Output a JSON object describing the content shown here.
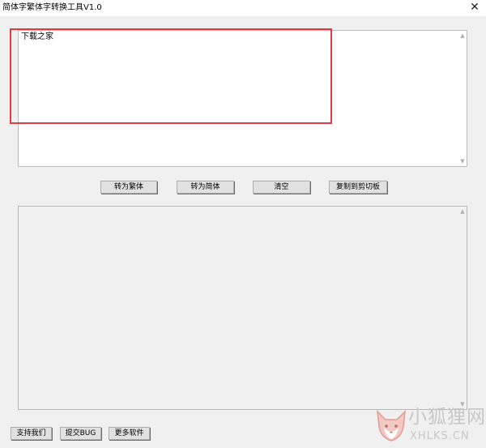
{
  "window": {
    "title": "简体字繁体字转换工具V1.0",
    "close_glyph": "✕"
  },
  "input_box": {
    "value": "下载之家"
  },
  "scroll": {
    "up_glyph": "▲",
    "down_glyph": "▼"
  },
  "buttons": {
    "to_traditional": "转为繁体",
    "to_simplified": "转为简体",
    "clear": "清空",
    "copy_clipboard": "复制到剪切板"
  },
  "footer_buttons": {
    "support": "支持我们",
    "submit_bug": "提交BUG",
    "more_software": "更多软件"
  },
  "watermark": {
    "name_cn": "小狐狸网",
    "name_en": "XHLKS.CN"
  },
  "colors": {
    "highlight": "#e63a43",
    "window_bg": "#f0f0f0"
  }
}
